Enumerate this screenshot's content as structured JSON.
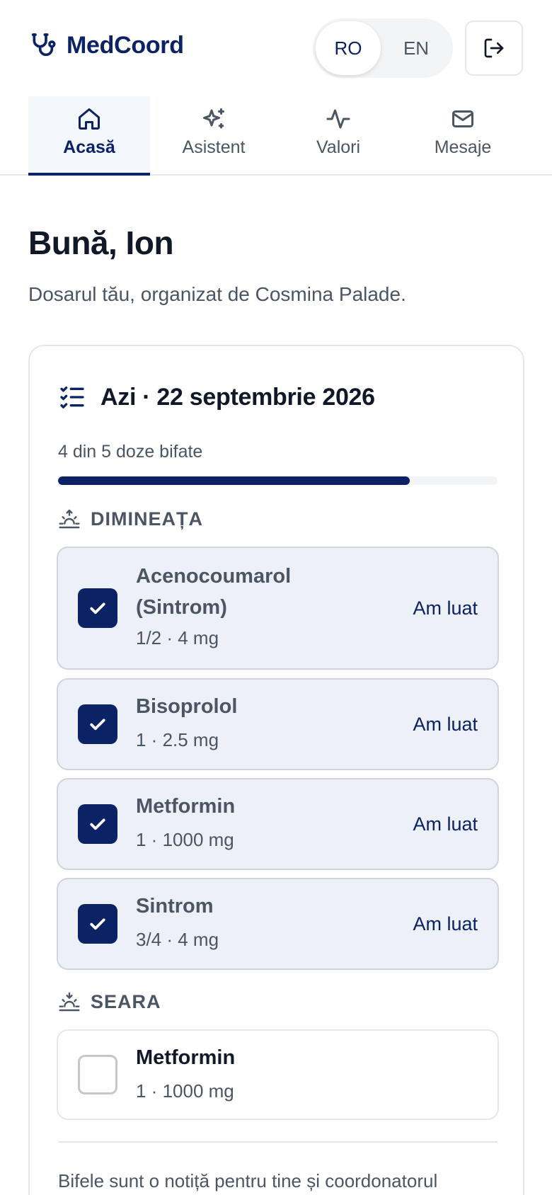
{
  "header": {
    "brand_name": "MedCoord",
    "lang_ro": "RO",
    "lang_en": "EN"
  },
  "tabs": [
    {
      "label": "Acasă",
      "icon": "home-icon"
    },
    {
      "label": "Asistent",
      "icon": "sparkles-icon"
    },
    {
      "label": "Valori",
      "icon": "activity-icon"
    },
    {
      "label": "Mesaje",
      "icon": "mail-icon"
    }
  ],
  "greeting": {
    "title": "Bună, Ion",
    "subtitle": "Dosarul tău, organizat de Cosmina Palade."
  },
  "today": {
    "title": "Azi · 22 septembrie 2026",
    "progress_text": "4 din 5 doze bifate",
    "progress_fraction": 0.8,
    "morning_label": "DIMINEAȚA",
    "evening_label": "SEARA",
    "morning_doses": [
      {
        "name": "Acenocoumarol (Sintrom)",
        "detail": "1/2 · 4 mg",
        "status": "Am luat",
        "checked": true
      },
      {
        "name": "Bisoprolol",
        "detail": "1 · 2.5 mg",
        "status": "Am luat",
        "checked": true
      },
      {
        "name": "Metformin",
        "detail": "1 · 1000 mg",
        "status": "Am luat",
        "checked": true
      },
      {
        "name": "Sintrom",
        "detail": "3/4 · 4 mg",
        "status": "Am luat",
        "checked": true
      }
    ],
    "evening_doses": [
      {
        "name": "Metformin",
        "detail": "1 · 1000 mg",
        "checked": false
      }
    ],
    "footnote": "Bifele sunt o notiță pentru tine și coordonatorul"
  },
  "colors": {
    "brand": "#0b2265",
    "checked_bg": "#edf0f7",
    "muted_text": "#4b5563"
  }
}
